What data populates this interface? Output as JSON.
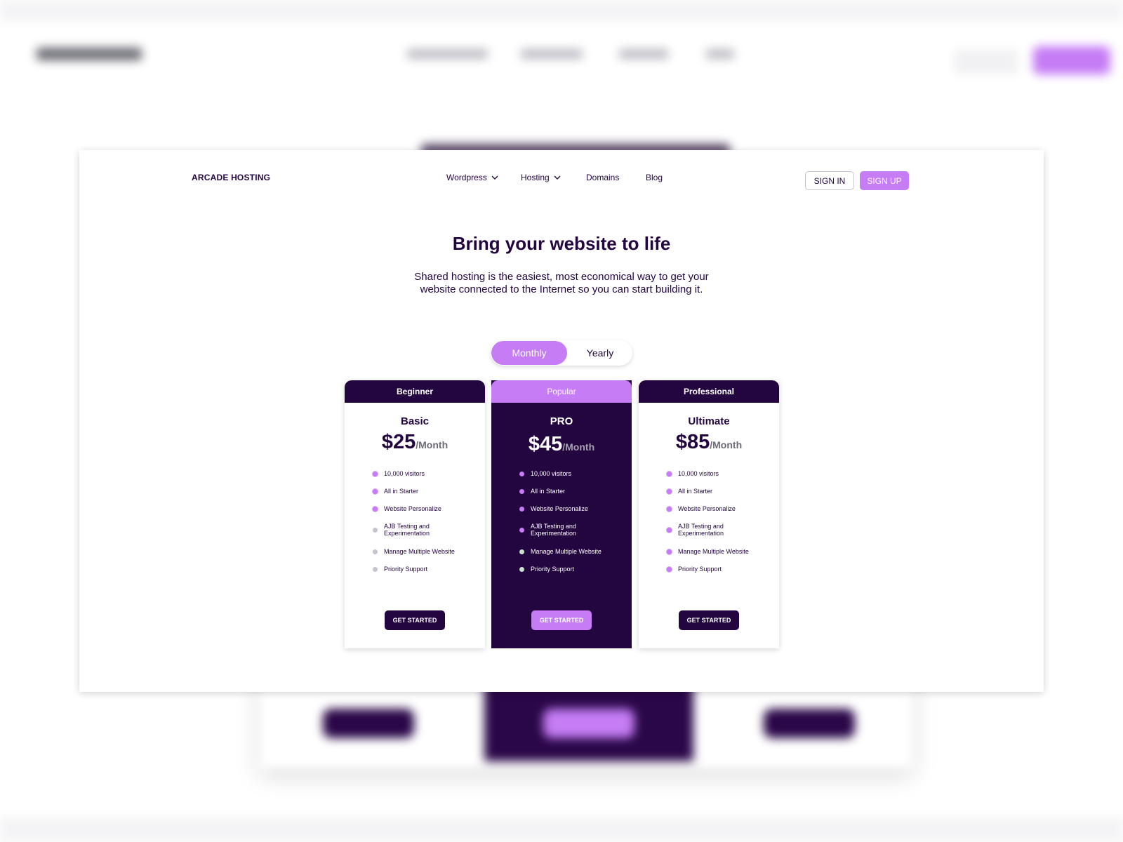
{
  "brand": "ARCADE HOSTING",
  "nav": {
    "items": [
      {
        "label": "Wordpress",
        "dropdown": true
      },
      {
        "label": "Hosting",
        "dropdown": true
      },
      {
        "label": "Domains",
        "dropdown": false
      },
      {
        "label": "Blog",
        "dropdown": false
      }
    ],
    "sign_in": "SIGN IN",
    "sign_up": "SIGN UP"
  },
  "hero": {
    "title": "Bring your website to life",
    "subtitle": "Shared hosting is the easiest, most economical way to get your website connected to the Internet so you can start building it."
  },
  "billing_toggle": {
    "options": [
      "Monthly",
      "Yearly"
    ],
    "selected": "Monthly"
  },
  "plans": [
    {
      "tier": "Beginner",
      "name": "Basic",
      "price": "$25",
      "period": "/Month",
      "highlighted": false,
      "features": [
        {
          "text": "10,000 visitors",
          "included": true
        },
        {
          "text": "All in Starter",
          "included": true
        },
        {
          "text": "Website Personalize",
          "included": true
        },
        {
          "text": "AJB Testing and Experimentation",
          "included": false
        },
        {
          "text": "Manage Multiple Website",
          "included": false
        },
        {
          "text": "Priority Support",
          "included": false
        }
      ],
      "cta": "GET STARTED"
    },
    {
      "tier": "Popular",
      "name": "PRO",
      "price": "$45",
      "period": "/Month",
      "highlighted": true,
      "features": [
        {
          "text": "10,000 visitors",
          "included": true
        },
        {
          "text": "All in Starter",
          "included": true
        },
        {
          "text": "Website Personalize",
          "included": true
        },
        {
          "text": "AJB Testing and Experimentation",
          "included": true
        },
        {
          "text": "Manage Multiple Website",
          "included": false
        },
        {
          "text": "Priority Support",
          "included": false
        }
      ],
      "cta": "GET STARTED"
    },
    {
      "tier": "Professional",
      "name": "Ultimate",
      "price": "$85",
      "period": "/Month",
      "highlighted": false,
      "features": [
        {
          "text": "10,000 visitors",
          "included": true
        },
        {
          "text": "All in Starter",
          "included": true
        },
        {
          "text": "Website Personalize",
          "included": true
        },
        {
          "text": "AJB Testing and Experimentation",
          "included": true
        },
        {
          "text": "Manage Multiple Website",
          "included": true
        },
        {
          "text": "Priority Support",
          "included": true
        }
      ],
      "cta": "GET STARTED"
    }
  ],
  "colors": {
    "primary_dark": "#23053f",
    "accent": "#c57cf5",
    "background": "#ffffff"
  },
  "icons": {
    "dropdown": "chevron-down-icon",
    "feature_included": "check-dot-icon",
    "feature_excluded": "dot-icon"
  }
}
